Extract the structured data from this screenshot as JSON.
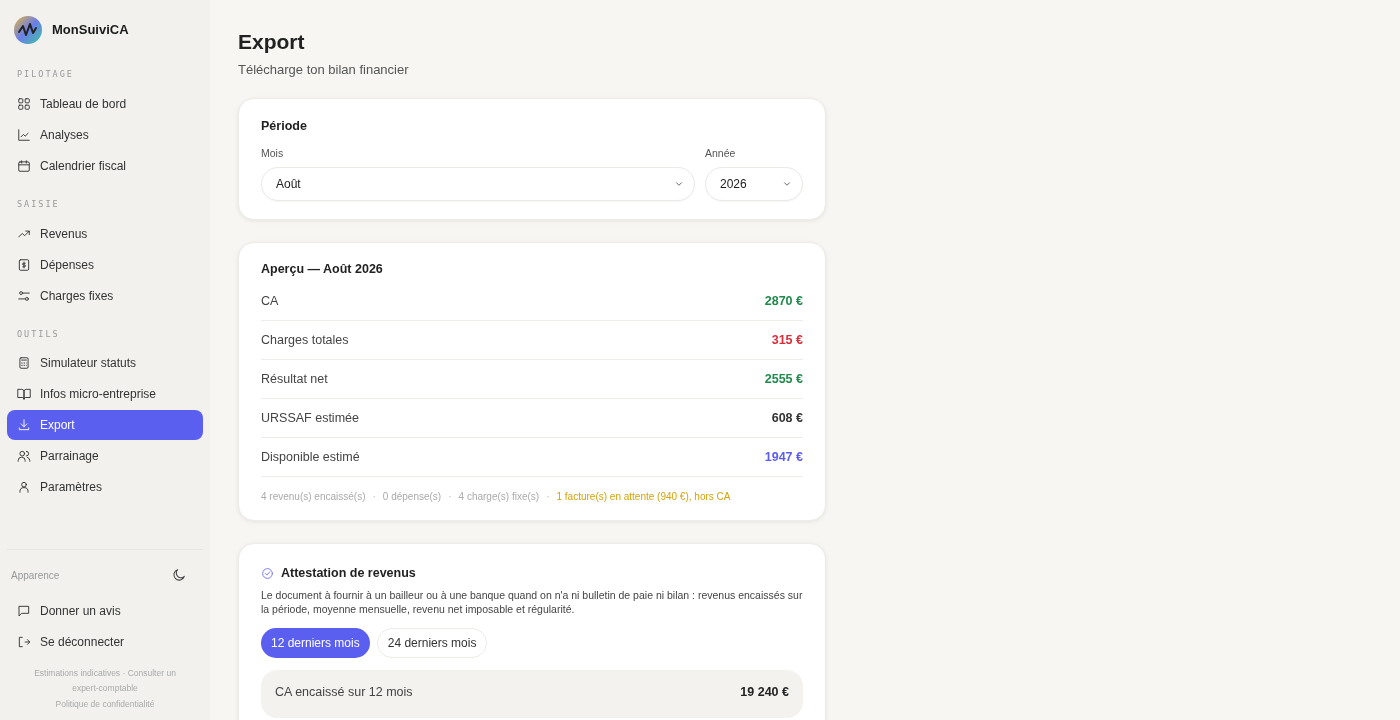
{
  "app": {
    "name": "MonSuiviCA"
  },
  "sidebar": {
    "sections": [
      {
        "title": "PILOTAGE",
        "items": [
          {
            "label": "Tableau de bord",
            "selected": false
          },
          {
            "label": "Analyses",
            "selected": false
          },
          {
            "label": "Calendrier fiscal",
            "selected": false
          }
        ]
      },
      {
        "title": "SAISIE",
        "items": [
          {
            "label": "Revenus",
            "selected": false
          },
          {
            "label": "Dépenses",
            "selected": false
          },
          {
            "label": "Charges fixes",
            "selected": false
          }
        ]
      },
      {
        "title": "OUTILS",
        "items": [
          {
            "label": "Simulateur statuts",
            "selected": false
          },
          {
            "label": "Infos micro-entreprise",
            "selected": false
          },
          {
            "label": "Export",
            "selected": true
          },
          {
            "label": "Parrainage",
            "selected": false
          },
          {
            "label": "Paramètres",
            "selected": false
          }
        ]
      }
    ],
    "appearance_label": "Apparence",
    "footer_items": [
      {
        "label": "Donner un avis"
      },
      {
        "label": "Se déconnecter"
      }
    ],
    "disclaimer": "Estimations indicatives · Consulter un expert-comptable",
    "privacy_link": "Politique de confidentialité"
  },
  "page": {
    "title": "Export",
    "subtitle": "Télécharge ton bilan financier"
  },
  "period": {
    "title": "Période",
    "month_label": "Mois",
    "month_value": "Août",
    "year_label": "Année",
    "year_value": "2026"
  },
  "preview": {
    "title": "Aperçu — Août 2026",
    "rows": [
      {
        "label": "CA",
        "value": "2870 €",
        "color": "#1f8a4c"
      },
      {
        "label": "Charges totales",
        "value": "315 €",
        "color": "#d92d3a"
      },
      {
        "label": "Résultat net",
        "value": "2555 €",
        "color": "#1f8a4c"
      },
      {
        "label": "URSSAF estimée",
        "value": "608 €",
        "color": "#333333"
      },
      {
        "label": "Disponible estimé",
        "value": "1947 €",
        "color": "#5b5cf0"
      }
    ],
    "note_separator": "·",
    "notes": [
      {
        "text": "4 revenu(s) encaissé(s)",
        "kind": "info"
      },
      {
        "text": "0 dépense(s)",
        "kind": "info"
      },
      {
        "text": "4 charge(s) fixe(s)",
        "kind": "info"
      },
      {
        "text": "1 facture(s) en attente (940 €), hors CA",
        "kind": "warning"
      }
    ]
  },
  "attestation": {
    "title": "Attestation de revenus",
    "description": "Le document à fournir à un bailleur ou à une banque quand on n'a ni bulletin de paie ni bilan : revenus encaissés sur la période, moyenne mensuelle, revenu net imposable et régularité.",
    "tabs": [
      {
        "label": "12 derniers mois",
        "selected": true
      },
      {
        "label": "24 derniers mois",
        "selected": false
      }
    ],
    "rows": [
      {
        "label": "CA encaissé sur 12 mois",
        "value": "19 240 €"
      }
    ]
  }
}
